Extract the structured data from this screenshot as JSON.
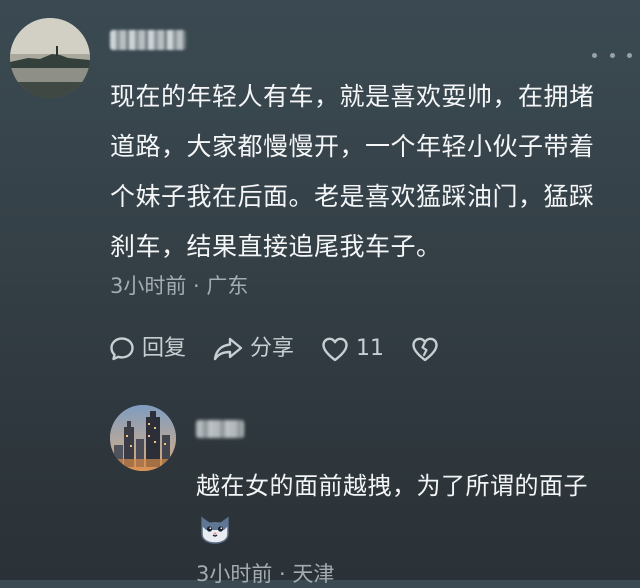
{
  "main_comment": {
    "text_lines": [
      "现在的年轻人有车，就是喜欢耍帅，在拥堵",
      "道路，大家都慢慢开，一个年轻小伙子带着",
      "个妹子我在后面。老是喜欢猛踩油门，猛踩",
      "刹车，结果直接追尾我车子。"
    ],
    "meta": "3小时前 · 广东",
    "actions": {
      "reply_label": "回复",
      "share_label": "分享",
      "like_count": "11"
    }
  },
  "reply": {
    "text": "越在女的面前越拽，为了所谓的面子",
    "meta": "3小时前 · 天津",
    "emoji": "cat-face-sticker-icon"
  },
  "colors": {
    "background_top": "#3b4a52",
    "background_bottom": "#2b3237",
    "text_primary": "#f4f6f7",
    "text_secondary": "#a3acb0",
    "icon": "#c8cfd2"
  }
}
